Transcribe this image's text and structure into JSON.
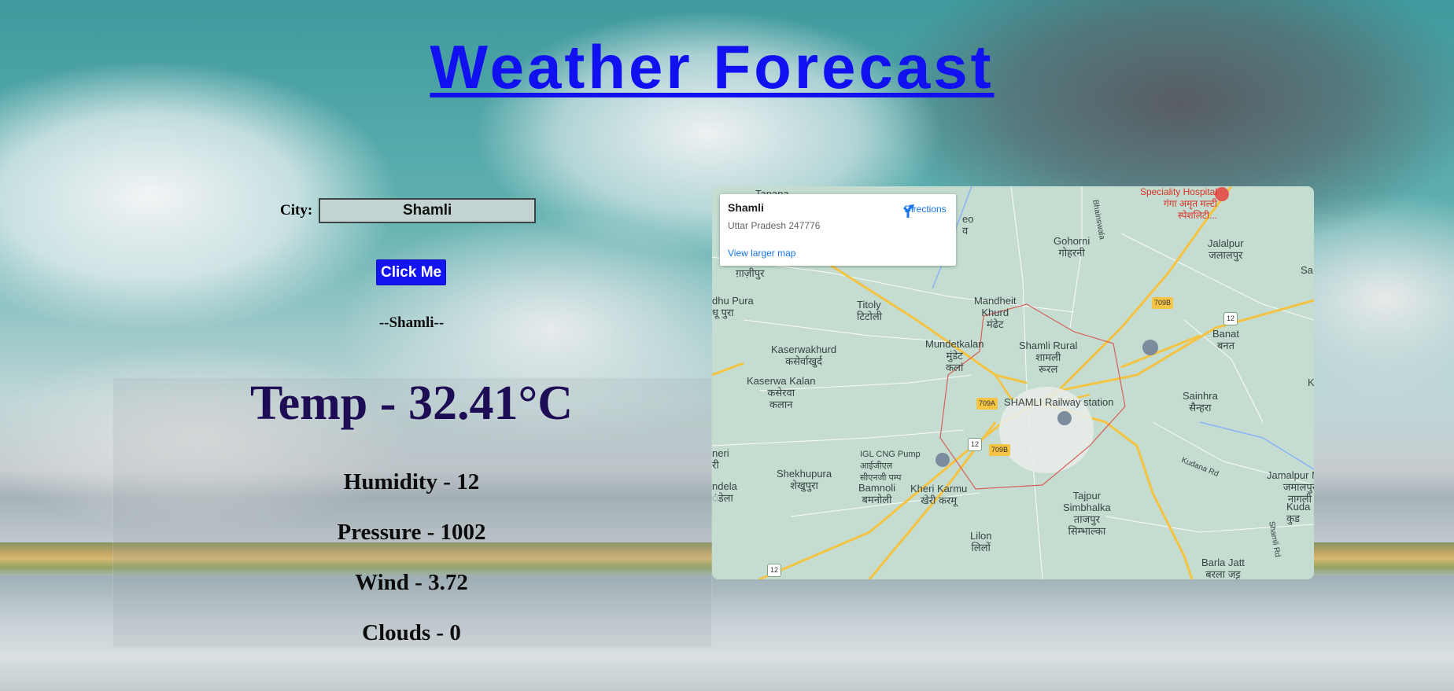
{
  "page": {
    "title": "Weather Forecast"
  },
  "search": {
    "label": "City:",
    "value": "Shamli",
    "button_label": "Click Me"
  },
  "result": {
    "city_echo": "--Shamli--",
    "temp": "Temp - 32.41°C",
    "humidity": "Humidity - 12",
    "pressure": "Pressure - 1002",
    "wind": "Wind - 3.72",
    "clouds": "Clouds - 0"
  },
  "map": {
    "place_name": "Shamli",
    "place_address": "Uttar Pradesh 247776",
    "directions_label": "Directions",
    "larger_map_label": "View larger map",
    "labels": {
      "tap": "Tapana",
      "ghazipur": "ग़ाज़ीपुर",
      "dhu_pura": "dhu Pura\nधू पुरा",
      "titoly": "Titoly\nटिटोली",
      "mandheit": "Mandheit\nKhurd\nमंढेट",
      "gohorni": "Gohorni\nगोहरनी",
      "jalalpur": "Jalalpur\nजलालपुर",
      "speciality": "Speciality Hospital\nगंगा अमृत मल्टी\nस्पेशलिटी...",
      "kaserwakhurd": "Kaserwakhurd\nकसेर्वाखुर्द",
      "mundetkalan": "Mundetkalan\nमुंडेट\nकलां",
      "shamli_rural": "Shamli Rural\nशामली\nरूरल",
      "banat": "Banat\nबनत",
      "kaserwa_kalan": "Kaserwa Kalan\nकसेरवा\nकलान",
      "railway": "SHAMLI Railway station",
      "sainhra": "Sainhra\nसैन्हरा",
      "igl": "IGL CNG Pump\nआईजीएल\nसीएनजी पम्प",
      "shekhupura": "Shekhupura\nशेखुपुरा",
      "bamnoli": "Bamnoli\nबमनोली",
      "kheri_karmu": "Kheri Karmu\nखेरी करमू",
      "tajpur": "Tajpur\nSimbhalka\nताजपुर\nसिम्भाल्का",
      "jamalpur": "Jamalpur Nagl\nजमालपुर\nनागली",
      "kuda": "Kuda\nकुड",
      "lilon": "Lilon\nलिलों",
      "barla_jatt": "Barla Jatt\nबरला जट्ट",
      "meri": "neri\nरी",
      "andela": "ndela\nंडेला",
      "shield_709a": "709A",
      "shield_709b_top": "709B",
      "shield_709b": "709B",
      "shield_12_right": "12",
      "shield_12_mid": "12",
      "shield_12_bottom": "12",
      "kudana_rd": "Kudana Rd",
      "bhainswala": "Bhainswala",
      "eo": "eo\nव",
      "sa": "Sa",
      "k": "K",
      "shamli_rd": "Shamli Rd"
    }
  }
}
